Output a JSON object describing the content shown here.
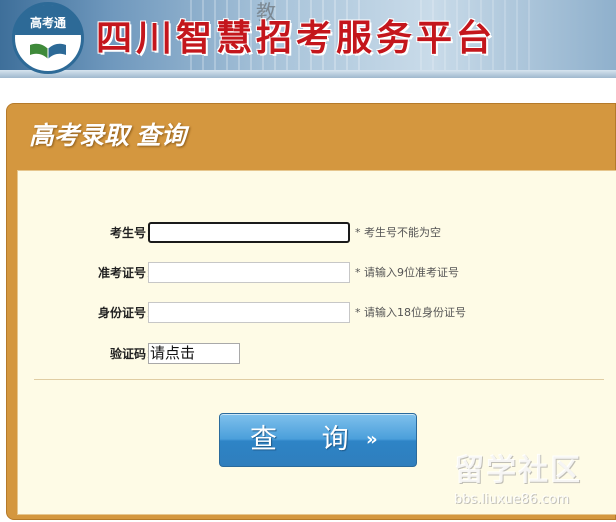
{
  "header": {
    "logo_text": "高考通",
    "site_title": "四川智慧招考服务平台",
    "banner_sign": "教"
  },
  "panel": {
    "title": "高考录取  查询"
  },
  "form": {
    "fields": [
      {
        "label": "考生号：",
        "value": "",
        "hint": "* 考生号不能为空"
      },
      {
        "label": "准考证号：",
        "value": "",
        "hint": "* 请输入9位准考证号"
      },
      {
        "label": "身份证号：",
        "value": "",
        "hint": "* 请输入18位身份证号"
      }
    ],
    "captcha": {
      "label": "验证码：",
      "text": "请点击"
    },
    "submit_label": "查 询",
    "submit_icon": "double-chevron-right-icon",
    "submit_arrow": "»"
  },
  "watermark": {
    "main": "留学社区",
    "sub": "bbs.liuxue86.com"
  },
  "colors": {
    "brand_red": "#c4161c",
    "panel_orange": "#d4973f",
    "form_bg": "#fefbe6",
    "button_blue": "#3b8fd2"
  }
}
